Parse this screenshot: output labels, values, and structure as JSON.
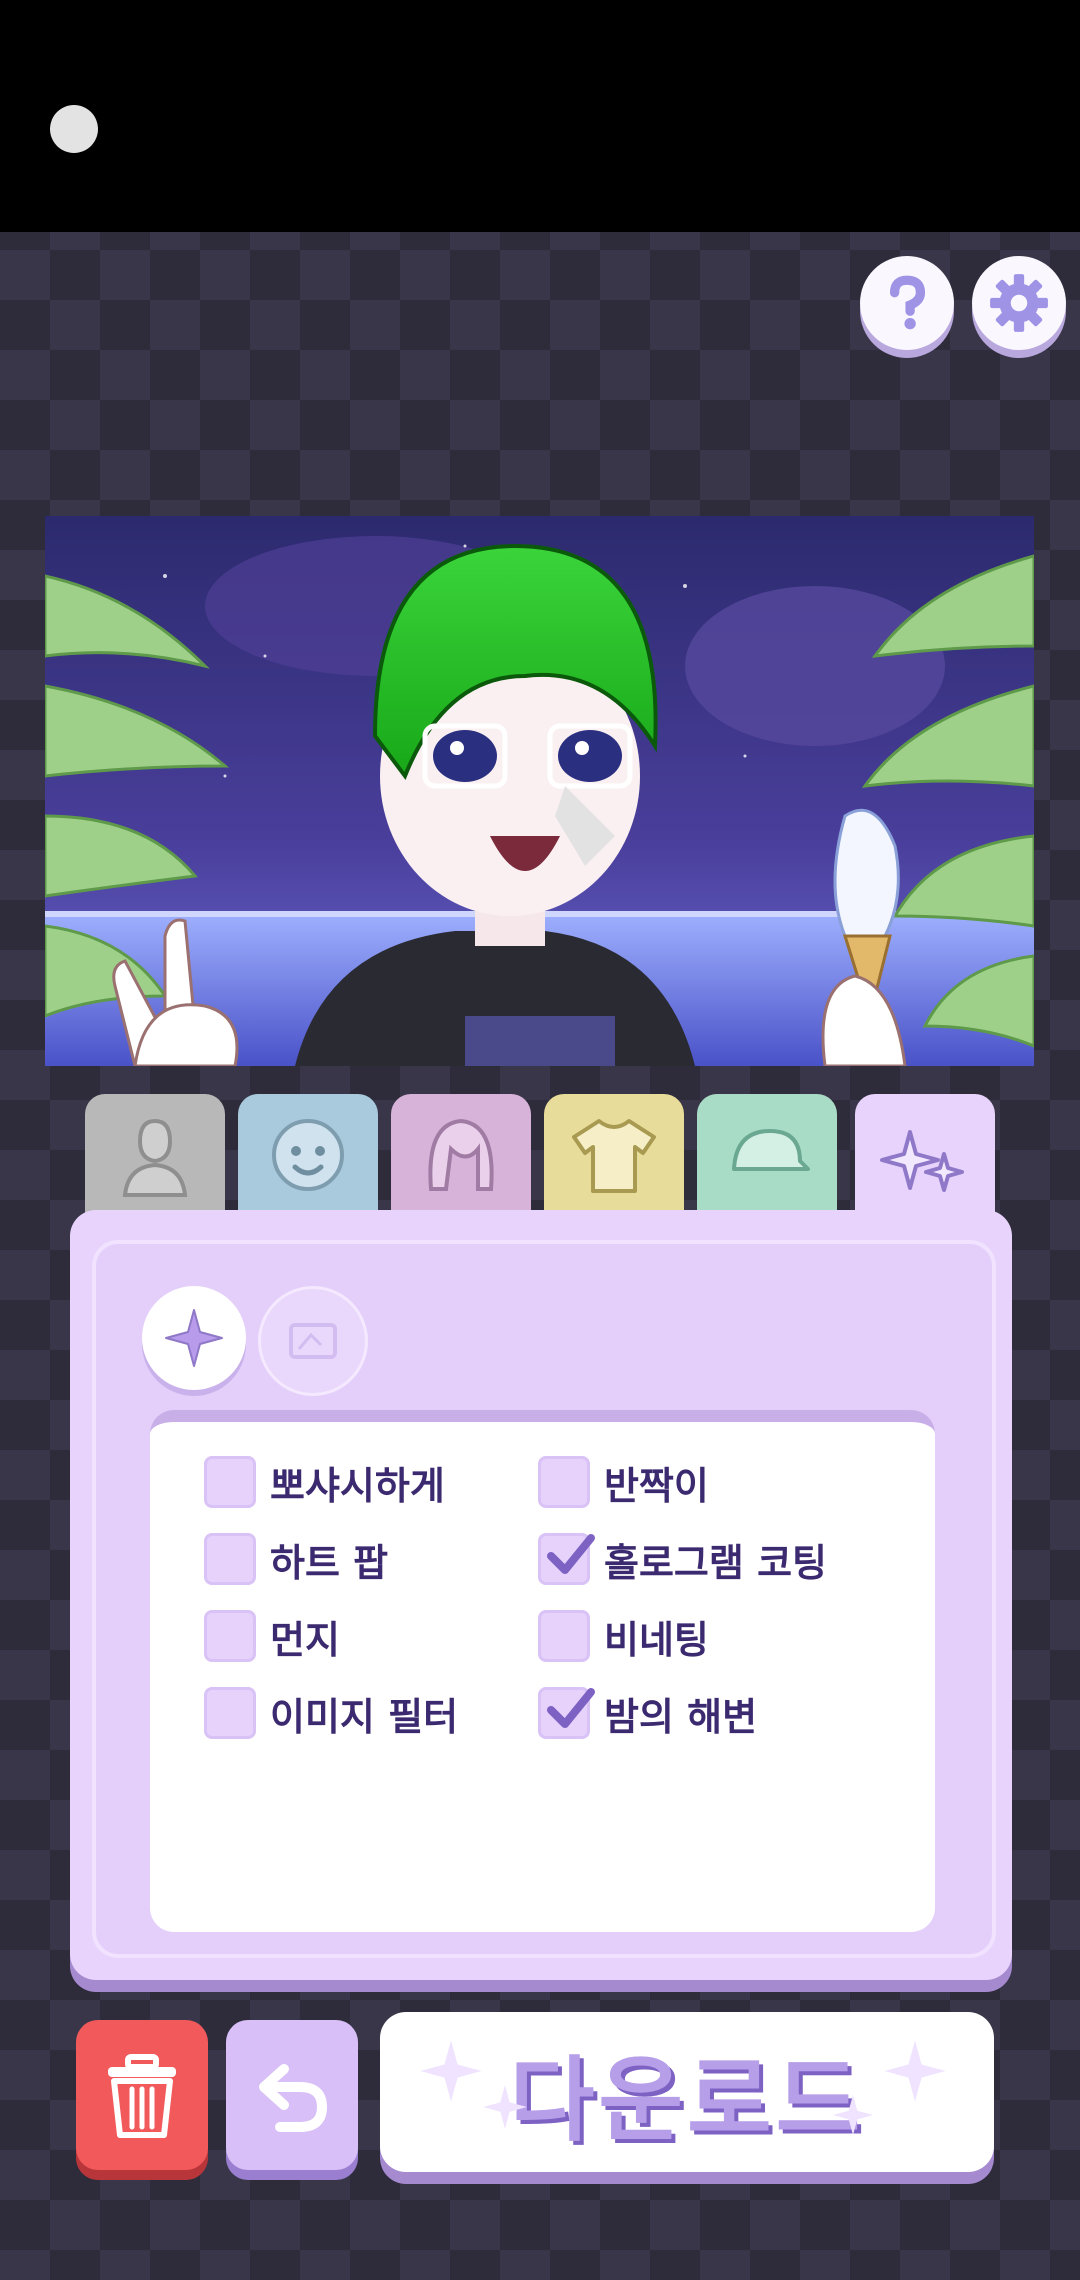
{
  "top_buttons": {
    "help_icon": "question-mark-icon",
    "settings_icon": "gear-icon"
  },
  "scene": {
    "description_icons": [
      "palm-tree-icon",
      "character-icon",
      "ice-cream-icon"
    ]
  },
  "tabs": [
    {
      "name": "body",
      "icon": "person-silhouette-icon",
      "color": "#b8b8b8"
    },
    {
      "name": "face",
      "icon": "smiling-face-icon",
      "color": "#a9c9dc"
    },
    {
      "name": "hair",
      "icon": "hair-icon",
      "color": "#d7b3d9"
    },
    {
      "name": "clothes",
      "icon": "t-shirt-icon",
      "color": "#e8dc9a"
    },
    {
      "name": "hat",
      "icon": "cap-icon",
      "color": "#a9dcc7"
    },
    {
      "name": "effects",
      "icon": "sparkles-icon",
      "color": "#e7d3fb",
      "active": true
    }
  ],
  "subtabs": [
    {
      "icon": "star-burst-icon",
      "active": true
    },
    {
      "icon": "picture-frame-icon",
      "active": false
    }
  ],
  "options": [
    {
      "label": "뽀샤시하게",
      "checked": false
    },
    {
      "label": "반짝이",
      "checked": false
    },
    {
      "label": "하트 팝",
      "checked": false
    },
    {
      "label": "홀로그램 코팅",
      "checked": true
    },
    {
      "label": "먼지",
      "checked": false
    },
    {
      "label": "비네팅",
      "checked": false
    },
    {
      "label": "이미지 필터",
      "checked": false
    },
    {
      "label": "밤의 해변",
      "checked": true
    }
  ],
  "actions": {
    "delete_icon": "trash-icon",
    "undo_icon": "undo-arrow-icon",
    "download_label": "다운로드"
  },
  "colors": {
    "accent": "#7d62c4",
    "panel": "#e7d3fb",
    "delete": "#f1595a",
    "text": "#3c2a70"
  }
}
